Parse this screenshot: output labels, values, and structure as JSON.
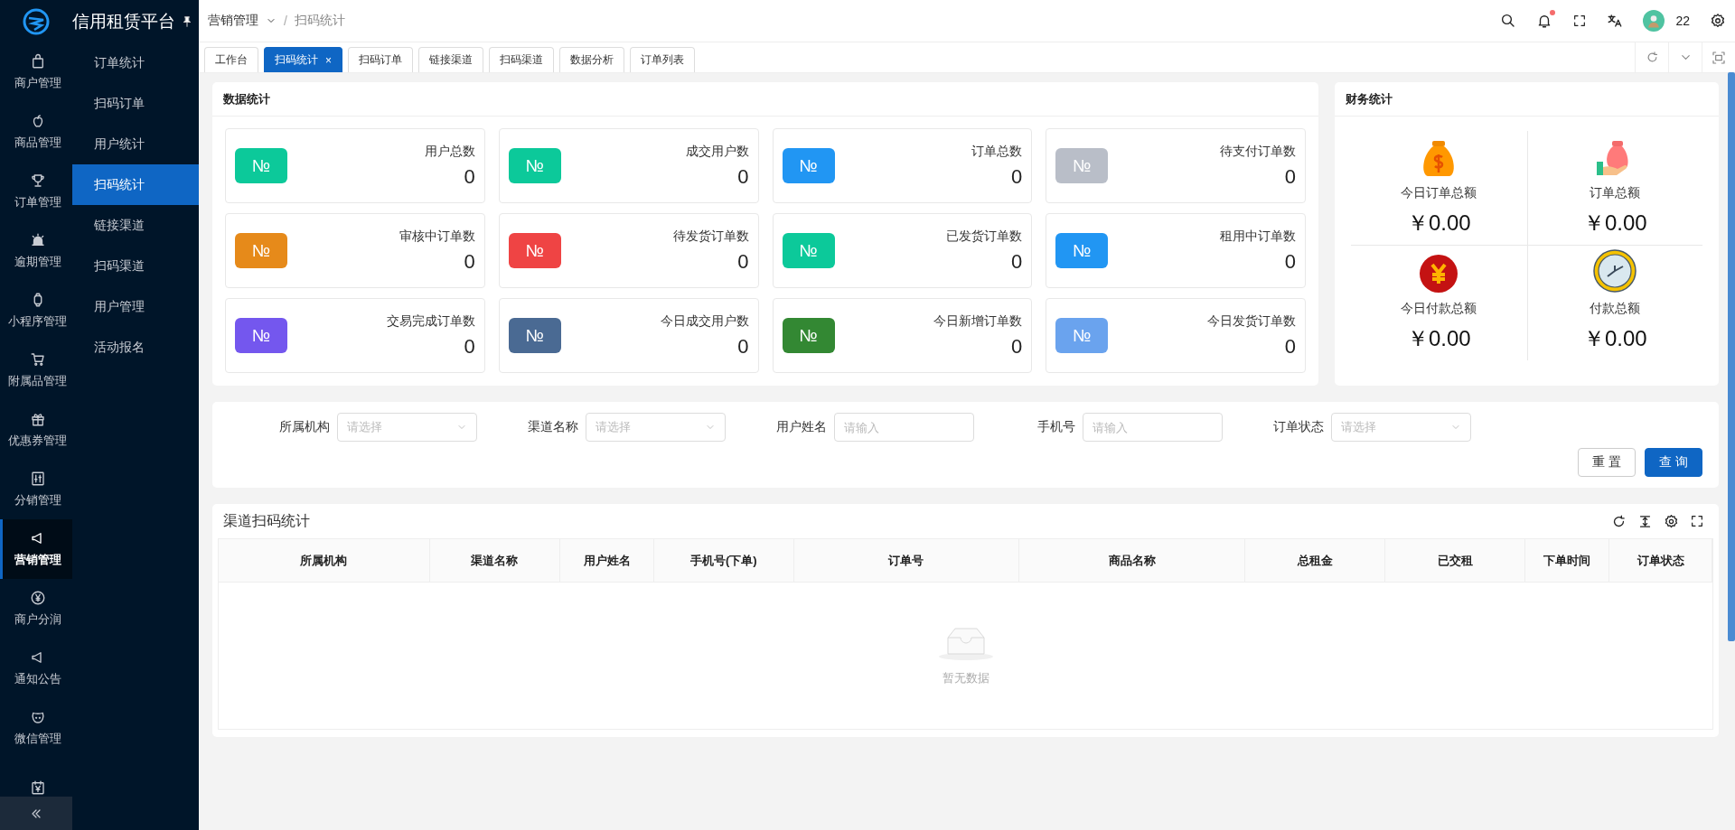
{
  "app": {
    "title": "信用租赁平台"
  },
  "rail": [
    {
      "label": "商户管理",
      "selected": false
    },
    {
      "label": "商品管理",
      "selected": false
    },
    {
      "label": "订单管理",
      "selected": false
    },
    {
      "label": "逾期管理",
      "selected": false
    },
    {
      "label": "小程序管理",
      "selected": false
    },
    {
      "label": "附属品管理",
      "selected": false
    },
    {
      "label": "优惠券管理",
      "selected": false
    },
    {
      "label": "分销管理",
      "selected": false
    },
    {
      "label": "营销管理",
      "selected": true
    },
    {
      "label": "商户分润",
      "selected": false
    },
    {
      "label": "通知公告",
      "selected": false
    },
    {
      "label": "微信管理",
      "selected": false
    },
    {
      "selected": false
    }
  ],
  "submenu": [
    {
      "label": "订单统计",
      "selected": false
    },
    {
      "label": "扫码订单",
      "selected": false
    },
    {
      "label": "用户统计",
      "selected": false
    },
    {
      "label": "扫码统计",
      "selected": true
    },
    {
      "label": "链接渠道",
      "selected": false
    },
    {
      "label": "扫码渠道",
      "selected": false
    },
    {
      "label": "用户管理",
      "selected": false
    },
    {
      "label": "活动报名",
      "selected": false
    }
  ],
  "breadcrumb": [
    "营销管理",
    "扫码统计"
  ],
  "breadcrumb_separator": "/",
  "header": {
    "notification_dot": true,
    "user": "22"
  },
  "tabs": [
    {
      "label": "工作台",
      "selected": false
    },
    {
      "label": "扫码统计",
      "selected": true,
      "close": "×"
    },
    {
      "label": "扫码订单",
      "selected": false
    },
    {
      "label": "链接渠道",
      "selected": false
    },
    {
      "label": "扫码渠道",
      "selected": false
    },
    {
      "label": "数据分析",
      "selected": false
    },
    {
      "label": "订单列表",
      "selected": false
    }
  ],
  "data_stats": {
    "title": "数据统计",
    "items": [
      {
        "label": "用户总数",
        "value": "0",
        "badge": "№",
        "color": "#0cc99a"
      },
      {
        "label": "成交用户数",
        "value": "0",
        "badge": "№",
        "color": "#0cc99a"
      },
      {
        "label": "订单总数",
        "value": "0",
        "badge": "№",
        "color": "#2196f3"
      },
      {
        "label": "待支付订单数",
        "value": "0",
        "badge": "№",
        "color": "#b9bec8"
      },
      {
        "label": "审核中订单数",
        "value": "0",
        "badge": "№",
        "color": "#e68a1a"
      },
      {
        "label": "待发货订单数",
        "value": "0",
        "badge": "№",
        "color": "#ef4444"
      },
      {
        "label": "已发货订单数",
        "value": "0",
        "badge": "№",
        "color": "#0cc99a"
      },
      {
        "label": "租用中订单数",
        "value": "0",
        "badge": "№",
        "color": "#2196f3"
      },
      {
        "label": "交易完成订单数",
        "value": "0",
        "badge": "№",
        "color": "#7457ee"
      },
      {
        "label": "今日成交用户数",
        "value": "0",
        "badge": "№",
        "color": "#4a6a93"
      },
      {
        "label": "今日新增订单数",
        "value": "0",
        "badge": "№",
        "color": "#338833"
      },
      {
        "label": "今日发货订单数",
        "value": "0",
        "badge": "№",
        "color": "#6aa3ee"
      }
    ]
  },
  "finance": {
    "title": "财务统计",
    "items": [
      {
        "label": "今日订单总额",
        "value": "￥0.00"
      },
      {
        "label": "订单总额",
        "value": "￥0.00"
      },
      {
        "label": "今日付款总额",
        "value": "￥0.00"
      },
      {
        "label": "付款总额",
        "value": "￥0.00"
      }
    ]
  },
  "filters": [
    {
      "label": "所属机构",
      "kind": "select",
      "placeholder": "请选择"
    },
    {
      "label": "渠道名称",
      "kind": "select",
      "placeholder": "请选择"
    },
    {
      "label": "用户姓名",
      "kind": "input",
      "placeholder": "请输入"
    },
    {
      "label": "手机号",
      "kind": "input",
      "placeholder": "请输入"
    },
    {
      "label": "订单状态",
      "kind": "select",
      "placeholder": "请选择"
    }
  ],
  "filter_buttons": [
    {
      "label": "重 置",
      "kind": "default"
    },
    {
      "label": "查 询",
      "kind": "primary"
    }
  ],
  "table": {
    "title": "渠道扫码统计",
    "columns": [
      "所属机构",
      "渠道名称",
      "用户姓名",
      "手机号(下单)",
      "订单号",
      "商品名称",
      "总租金",
      "已交租",
      "下单时间",
      "订单状态"
    ],
    "empty_text": "暂无数据"
  }
}
